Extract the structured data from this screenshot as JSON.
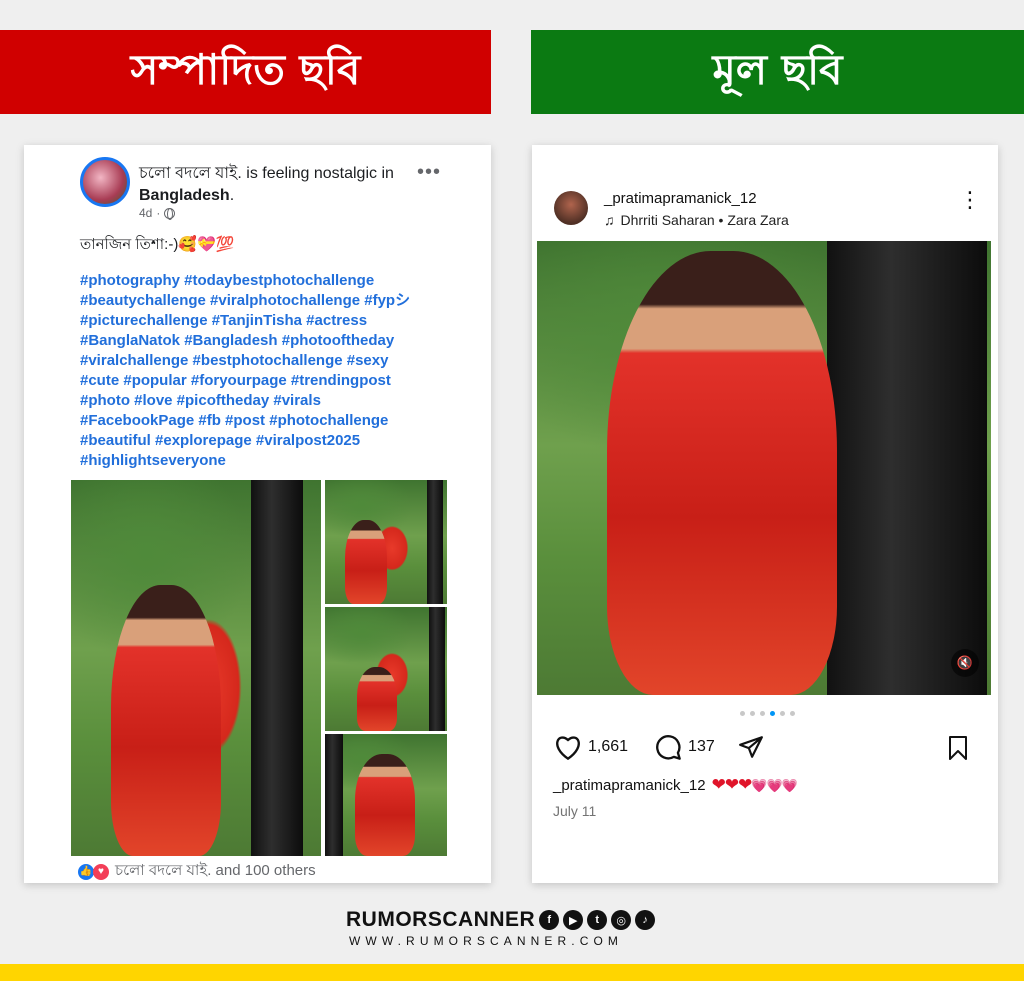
{
  "banners": {
    "left": "সম্পাদিত ছবি",
    "right": "মূল ছবি"
  },
  "facebook_post": {
    "author": "চলো বদলে যাই.",
    "activity_prefix": " is feeling nostalgic in",
    "location": "Bangladesh",
    "location_suffix": ".",
    "time": "4d",
    "caption": "তানজিন তিশা:-)🥰💝💯",
    "hashtag_lines": [
      "#photography #todaybestphotochallenge",
      "#beautychallenge #viralphotochallenge #fypシ",
      "#picturechallenge #TanjinTisha #actress",
      "#BanglaNatok #Bangladesh #photooftheday",
      "#viralchallenge #bestphotochallenge #sexy",
      "#cute #popular #foryourpage #trendingpost",
      "#photo #love #picoftheday #virals",
      "#FacebookPage #fb #post #photochallenge",
      "#beautiful #explorepage #viralpost2025",
      "#highlightseveryone"
    ],
    "reactions_text": "চলো বদলে যাই. and 100 others",
    "more": "•••"
  },
  "instagram_post": {
    "username": "_pratimapramanick_12",
    "music": "Dhrriti Saharan • Zara Zara",
    "likes": "1,661",
    "comments": "137",
    "caption_user": "_pratimapramanick_12",
    "date": "July 11",
    "more": "⋮"
  },
  "footer": {
    "brand": "RUMORSCANNER",
    "website": "WWW.RUMORSCANNER.COM",
    "social_icons": [
      "facebook-icon",
      "youtube-icon",
      "twitter-icon",
      "instagram-icon",
      "tiktok-icon"
    ]
  },
  "colors": {
    "edited_banner": "#d00000",
    "original_banner": "#0b7a12",
    "hashtag": "#216fdb",
    "footer_bar": "#ffd500"
  }
}
